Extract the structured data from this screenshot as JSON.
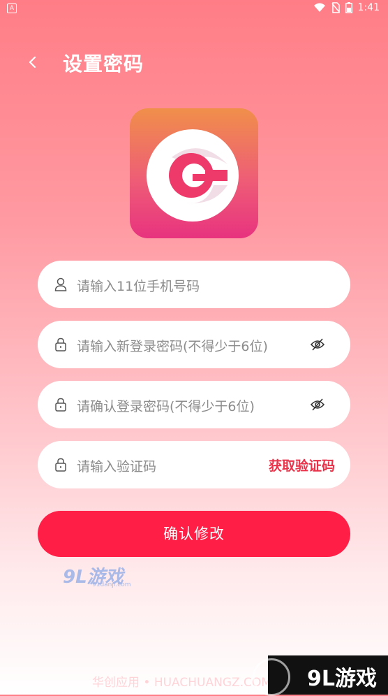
{
  "status_bar": {
    "left_icon": "A",
    "time": "1:41",
    "icons": [
      "wifi-icon",
      "no-sim-icon",
      "battery-icon"
    ]
  },
  "header": {
    "title": "设置密码",
    "back_icon": "chevron-left-icon"
  },
  "form": {
    "phone": {
      "placeholder": "请输入11位手机号码",
      "icon": "user-icon"
    },
    "new_password": {
      "placeholder": "请输入新登录密码(不得少于6位)",
      "icon": "lock-icon",
      "toggle_icon": "eye-off-icon"
    },
    "confirm_password": {
      "placeholder": "请确认登录密码(不得少于6位)",
      "icon": "lock-icon",
      "toggle_icon": "eye-off-icon"
    },
    "verify_code": {
      "placeholder": "请输入验证码",
      "icon": "lock-icon",
      "action_label": "获取验证码"
    }
  },
  "submit_label": "确认修改",
  "watermarks": {
    "site_logo": "9L游戏",
    "site_url": "91danji.com",
    "footer_text": "华创应用 • HUACHUANGZ.COM",
    "corner_logo": "9L游戏"
  },
  "colors": {
    "accent": "#ff1f46",
    "code_button": "#e8334a",
    "background_top": "#ff7d86",
    "background_bottom": "#ffffff"
  }
}
